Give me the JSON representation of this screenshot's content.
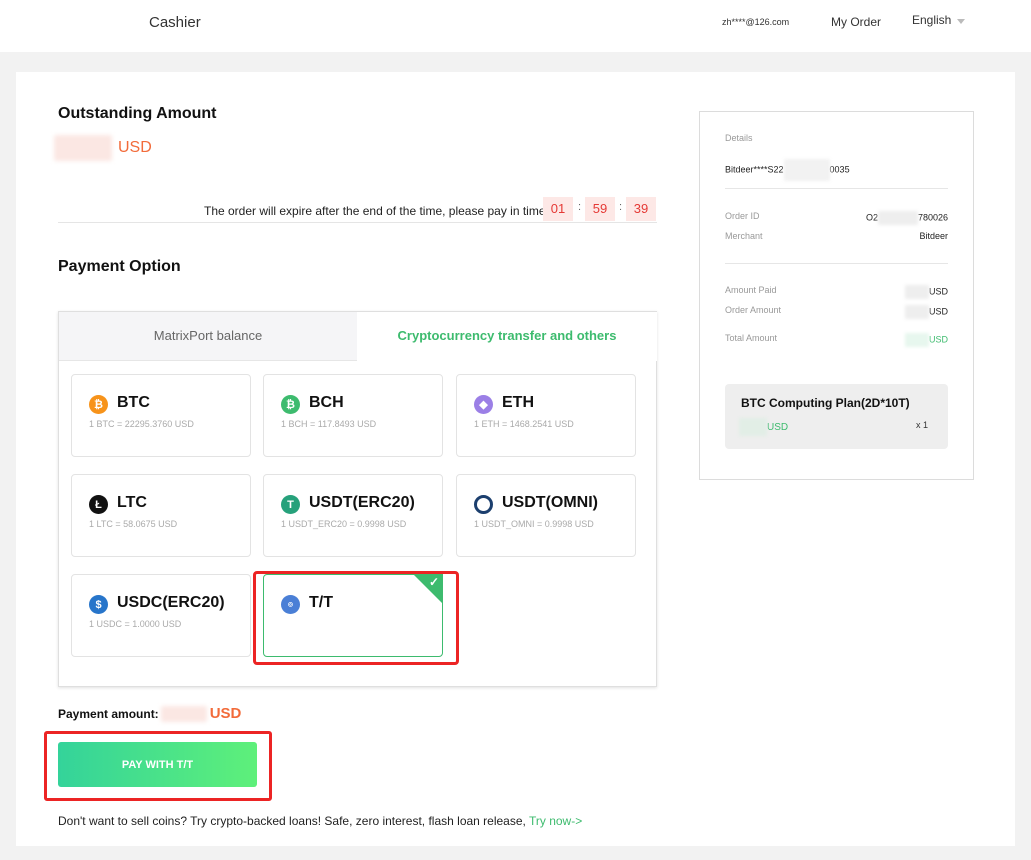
{
  "header": {
    "brand": "Cashier",
    "user_email": "zh****@126.com",
    "my_order": "My Order",
    "language": "English"
  },
  "outstanding": {
    "title": "Outstanding Amount",
    "currency": "USD"
  },
  "expiry": {
    "message": "The order will expire after the end of the time, please pay in time",
    "hours": "01",
    "minutes": "59",
    "seconds": "39",
    "separator": ":"
  },
  "payment_option": {
    "title": "Payment Option",
    "tabs": [
      {
        "label": "MatrixPort balance",
        "active": false
      },
      {
        "label": "Cryptocurrency transfer and others",
        "active": true
      }
    ],
    "coins": [
      {
        "name": "BTC",
        "rate": "1 BTC = 22295.3760 USD",
        "icon": "btc-icon",
        "color": "#f7931a"
      },
      {
        "name": "BCH",
        "rate": "1 BCH = 117.8493 USD",
        "icon": "bch-icon",
        "color": "#3dbb6e"
      },
      {
        "name": "ETH",
        "rate": "1 ETH = 1468.2541 USD",
        "icon": "eth-icon",
        "color": "#9b7fe6"
      },
      {
        "name": "LTC",
        "rate": "1 LTC = 58.0675 USD",
        "icon": "ltc-icon",
        "color": "#111111"
      },
      {
        "name": "USDT(ERC20)",
        "rate": "1 USDT_ERC20 = 0.9998 USD",
        "icon": "usdt-icon",
        "color": "#26a17b"
      },
      {
        "name": "USDT(OMNI)",
        "rate": "1 USDT_OMNI = 0.9998 USD",
        "icon": "omni-icon",
        "color": "#1c3f6e"
      },
      {
        "name": "USDC(ERC20)",
        "rate": "1 USDC = 1.0000 USD",
        "icon": "usdc-icon",
        "color": "#2775ca"
      },
      {
        "name": "T/T",
        "rate": "",
        "icon": "swift-icon",
        "color": "#4a7fd6",
        "selected": true
      }
    ]
  },
  "payment_amount": {
    "label": "Payment amount:",
    "currency": "USD"
  },
  "pay_button": "PAY WITH T/T",
  "loan": {
    "text": "Don't want to sell coins? Try crypto-backed loans! Safe, zero interest, flash loan release, ",
    "link": "Try now->"
  },
  "details": {
    "title": "Details",
    "product_code_prefix": "Bitdeer****S22",
    "product_code_suffix": "0035",
    "order_id_label": "Order ID",
    "order_id_prefix": "O2",
    "order_id_suffix": "780026",
    "merchant_label": "Merchant",
    "merchant_value": "Bitdeer",
    "amount_paid_label": "Amount Paid",
    "order_amount_label": "Order Amount",
    "total_amount_label": "Total Amount",
    "currency": "USD",
    "plan_title": "BTC Computing Plan(2D*10T)",
    "plan_currency": "USD",
    "plan_qty": "x 1"
  },
  "colors": {
    "accent_green": "#3dbb6e",
    "accent_orange": "#f26b3a",
    "timer_red": "#e53935",
    "highlight_red": "#ec2424"
  }
}
